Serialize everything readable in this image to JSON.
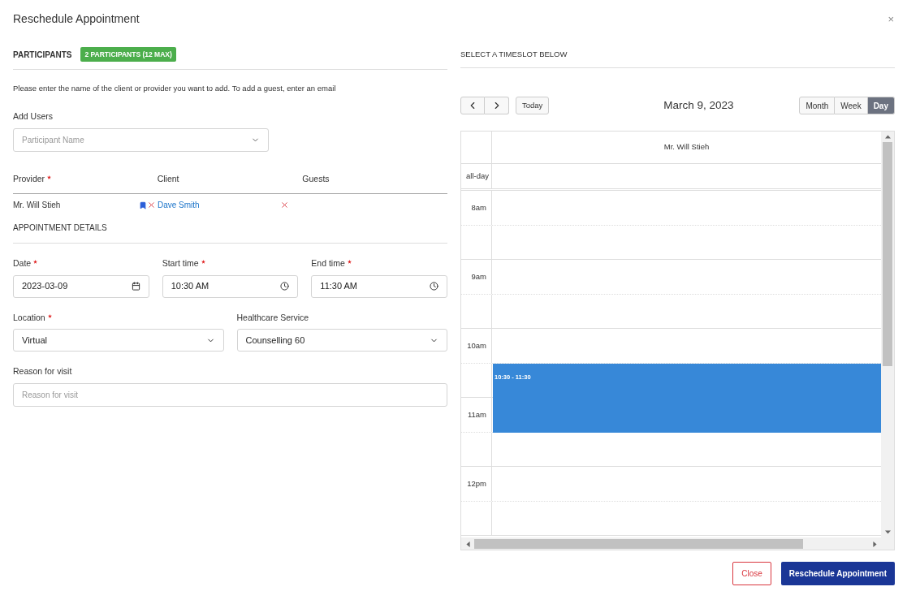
{
  "dialog": {
    "title": "Reschedule Appointment",
    "close_icon": "×"
  },
  "participants": {
    "heading": "PARTICIPANTS",
    "badge": "2 PARTICIPANTS (12 MAX)",
    "instructions": "Please enter the name of the client or provider you want to add. To add a guest, enter an email",
    "add_users": {
      "label": "Add Users",
      "placeholder": "Participant Name"
    },
    "columns": [
      {
        "label": "Provider",
        "required": true
      },
      {
        "label": "Client",
        "required": false
      },
      {
        "label": "Guests",
        "required": false
      }
    ],
    "provider": {
      "name": "Mr. Will Stieh",
      "bookmarked": true
    },
    "client": {
      "name": "Dave Smith"
    }
  },
  "details": {
    "heading": "APPOINTMENT DETAILS",
    "date": {
      "label": "Date",
      "required": true,
      "value": "2023-03-09"
    },
    "start_time": {
      "label": "Start time",
      "required": true,
      "value": "10:30 AM"
    },
    "end_time": {
      "label": "End time",
      "required": true,
      "value": "11:30 AM"
    },
    "location": {
      "label": "Location",
      "required": true,
      "value": "Virtual"
    },
    "healthcare_service": {
      "label": "Healthcare Service",
      "required": false,
      "value": "Counselling 60"
    },
    "reason": {
      "label": "Reason for visit",
      "placeholder": "Reason for visit"
    }
  },
  "calendar": {
    "heading": "SELECT A TIMESLOT BELOW",
    "today": "Today",
    "date": "March 9, 2023",
    "views": [
      {
        "label": "Month",
        "selected": false
      },
      {
        "label": "Week",
        "selected": false
      },
      {
        "label": "Day",
        "selected": true
      }
    ],
    "resource": "Mr. Will Stieh",
    "all_day": "all-day",
    "hours": [
      {
        "time": "8am"
      },
      {
        "time": "9am"
      },
      {
        "time": "10am",
        "half_hour_event": "10:30 - 11:30"
      },
      {
        "time": "11am"
      },
      {
        "time": "12pm"
      }
    ]
  },
  "buttons": {
    "close": "Close",
    "submit": "Reschedule Appointment"
  }
}
